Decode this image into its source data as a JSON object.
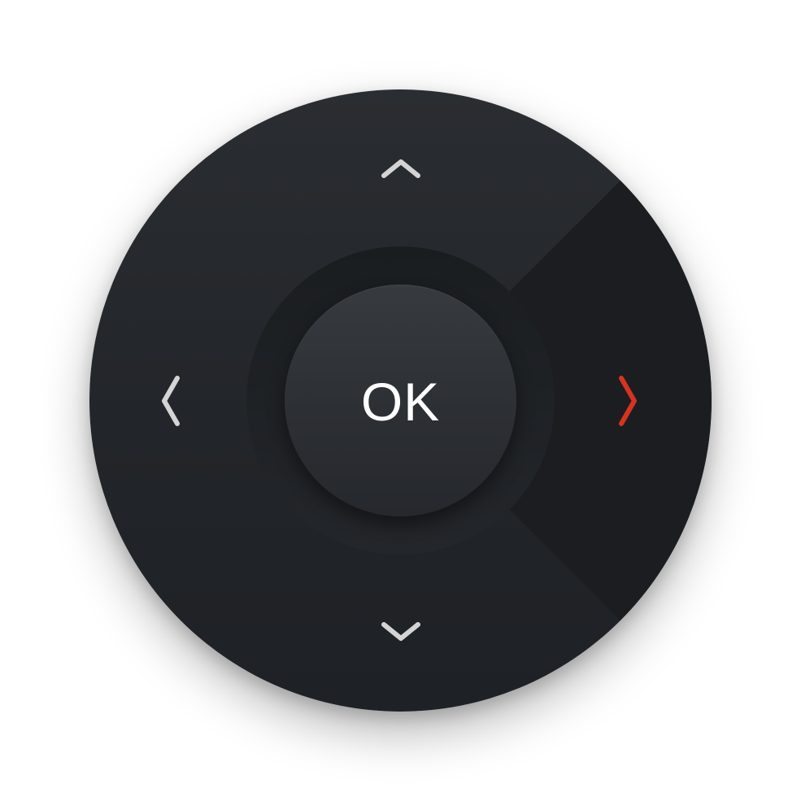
{
  "dpad": {
    "ok_label": "OK",
    "selected_direction": "right",
    "colors": {
      "body": "#24272b",
      "selected_segment": "#1b1d20",
      "arrow": "#d4d4d4",
      "arrow_selected": "#d5341e",
      "ok_text": "#ffffff"
    },
    "icons": {
      "up": "chevron-up-icon",
      "down": "chevron-down-icon",
      "left": "chevron-left-icon",
      "right": "chevron-right-icon"
    }
  }
}
